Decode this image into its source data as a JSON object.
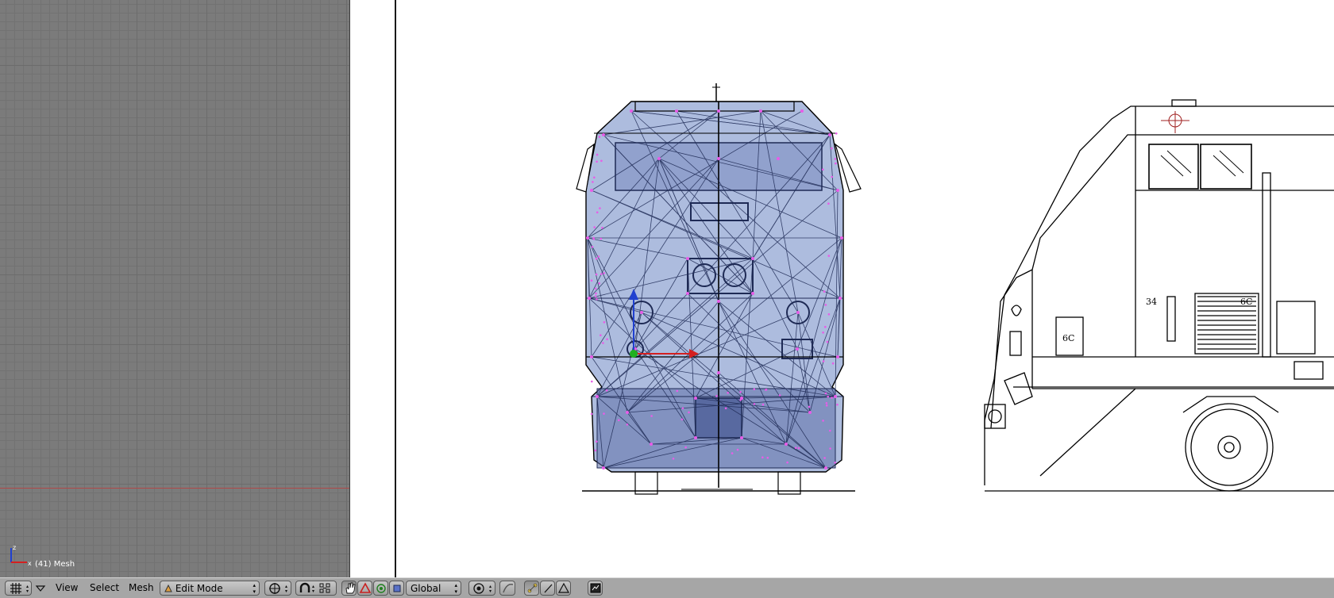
{
  "status": {
    "mesh_label": "(41) Mesh"
  },
  "axis_labels": {
    "z": "z",
    "x": "x"
  },
  "toolbar": {
    "view_label": "View",
    "select_label": "Select",
    "mesh_label": "Mesh",
    "mode_value": "Edit Mode",
    "orientation_value": "Global"
  },
  "icons": {
    "editor_type": "grid-icon",
    "mode": "edit-mode-icon",
    "pivot": "pivot-icon",
    "snap": "magnet-icon",
    "manipulator_translate": "hand-icon",
    "manipulator_rotate": "triangle-icon",
    "manipulator_scale": "circle-icon",
    "proportional": "proportional-icon",
    "select_vertex": "vertex-select-icon",
    "select_edge": "edge-select-icon",
    "select_face": "face-select-icon",
    "render": "render-icon"
  },
  "colors": {
    "mesh_fill": "#9fb0d8",
    "mesh_edge": "#1e2a55",
    "vertex": "#e85ce8",
    "toolbar_bg": "#a6a6a6",
    "grid_bg": "#7b7b7b",
    "axis_x": "#d42020",
    "axis_y": "#20b020",
    "axis_z": "#2040d0"
  }
}
